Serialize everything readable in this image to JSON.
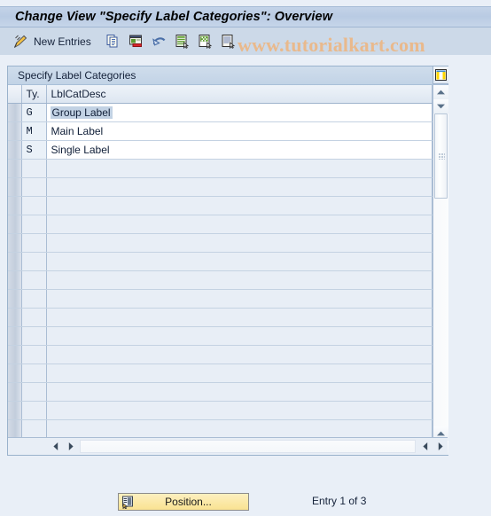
{
  "window": {
    "title": "Change View \"Specify Label Categories\": Overview"
  },
  "watermark": {
    "text": "www.tutorialkart.com",
    "color": "#e9b98c"
  },
  "toolbar": {
    "items": [
      {
        "icon": "change-pencil-icon",
        "label": ""
      },
      {
        "icon": "",
        "label": "New Entries"
      },
      {
        "icon": "copy-icon",
        "label": ""
      },
      {
        "icon": "delete-icon",
        "label": ""
      },
      {
        "icon": "undo-icon",
        "label": ""
      },
      {
        "icon": "select-all-icon",
        "label": ""
      },
      {
        "icon": "deselect-all-icon",
        "label": ""
      },
      {
        "icon": "select-layout-icon",
        "label": ""
      }
    ],
    "new_entries_label": "New Entries"
  },
  "panel": {
    "header": "Specify Label Categories"
  },
  "table": {
    "columns": [
      "Ty.",
      "LblCatDesc"
    ],
    "rows": [
      {
        "ty": "G",
        "desc": "Group Label",
        "selected": true
      },
      {
        "ty": "M",
        "desc": "Main Label",
        "selected": false
      },
      {
        "ty": "S",
        "desc": "Single Label",
        "selected": false
      }
    ],
    "empty_row_count": 16,
    "config_icon": "table-settings-icon"
  },
  "scrollbars": {
    "vertical": {
      "up_icon": "scroll-up-icon",
      "down_icon": "scroll-down-icon",
      "page_up_icon": "scroll-page-up-icon",
      "page_down_icon": "scroll-page-down-icon"
    },
    "horizontal": {
      "left_icon": "scroll-left-icon",
      "right_icon": "scroll-right-icon"
    }
  },
  "footer": {
    "position_button_label": "Position...",
    "position_button_icon": "position-icon",
    "entry_status": "Entry 1 of 3"
  },
  "colors": {
    "background": "#e9eff7",
    "titlebar": "#bfd0e6",
    "toolbar": "#ccd9e8",
    "panel_border": "#9ab2cc",
    "grid_line": "#aabdd4",
    "row_empty": "#e8eef6",
    "row_filled": "#ffffff",
    "ty_cell": "#eaf1f8",
    "button_yellow": "#fbe9a8"
  }
}
